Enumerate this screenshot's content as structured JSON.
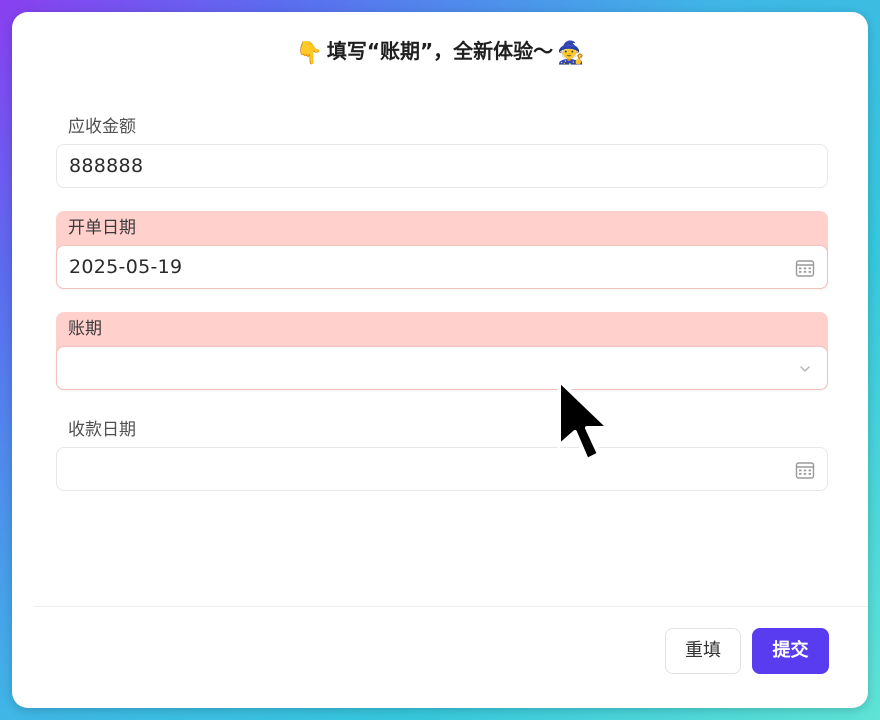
{
  "dialog": {
    "title_prefix_emoji": "👇",
    "title": "填写“账期”，全新体验～",
    "title_suffix_emoji": "🧙"
  },
  "form": {
    "fields": [
      {
        "label": "应收金额",
        "value": "888888",
        "icon": "",
        "state": "normal"
      },
      {
        "label": "开单日期",
        "value": "2025-05-19",
        "icon": "calendar-icon",
        "state": "error"
      },
      {
        "label": "账期",
        "value": "",
        "icon": "chevron-down-icon",
        "state": "error"
      },
      {
        "label": "收款日期",
        "value": "",
        "icon": "calendar-icon",
        "state": "normal"
      }
    ]
  },
  "footer": {
    "reset_label": "重填",
    "submit_label": "提交"
  },
  "colors": {
    "accent": "#5a3cf0",
    "error_bg": "#ffd0cc"
  }
}
